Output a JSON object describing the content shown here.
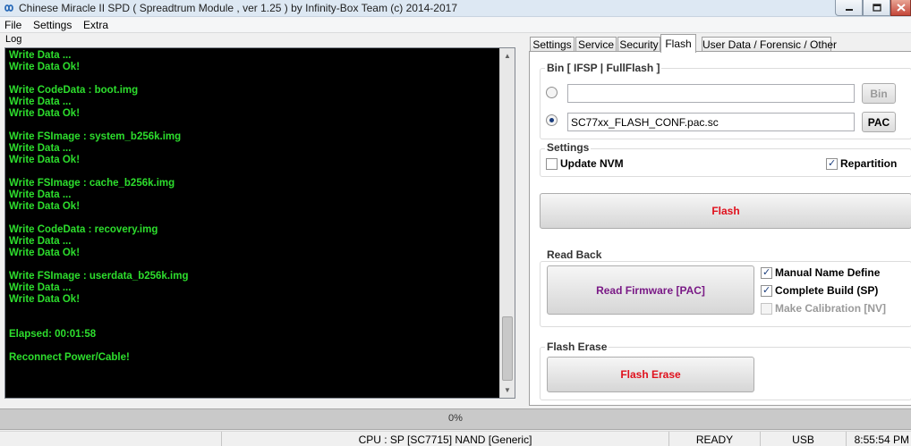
{
  "window": {
    "title": "Chinese Miracle II SPD ( Spreadtrum Module , ver 1.25 ) by Infinity-Box Team (c) 2014-2017"
  },
  "menu": [
    "File",
    "Settings",
    "Extra"
  ],
  "log": {
    "label": "Log",
    "lines": [
      "Write Data ...",
      "Write Data Ok!",
      "",
      "Write CodeData : boot.img",
      "Write Data ...",
      "Write Data Ok!",
      "",
      "Write FSImage : system_b256k.img",
      "Write Data ...",
      "Write Data Ok!",
      "",
      "Write FSImage : cache_b256k.img",
      "Write Data ...",
      "Write Data Ok!",
      "",
      "Write CodeData : recovery.img",
      "Write Data ...",
      "Write Data Ok!",
      "",
      "Write FSImage : userdata_b256k.img",
      "Write Data ...",
      "Write Data Ok!",
      "",
      "",
      "Elapsed: 00:01:58",
      "",
      "Reconnect Power/Cable!"
    ],
    "text_color": "#2dde2d"
  },
  "tabs": [
    "Settings",
    "Service",
    "Security",
    "Flash",
    "User Data / Forensic / Other"
  ],
  "active_tab": "Flash",
  "flash": {
    "bin_group_title": "Bin  [ IFSP | FullFlash ]",
    "bin_path": "",
    "bin_button": "Bin",
    "pac_path": "SC77xx_FLASH_CONF.pac.sc",
    "pac_button": "PAC",
    "settings_title": "Settings",
    "update_nvm": {
      "label": "Update NVM",
      "checked": false
    },
    "repartition": {
      "label": "Repartition",
      "checked": true
    },
    "flash_button": "Flash",
    "flash_button_color": "#e0101c",
    "readback_title": "Read Back",
    "read_firmware_button": "Read Firmware [PAC]",
    "read_firmware_color": "#7a1a86",
    "manual_name": {
      "label": "Manual Name Define",
      "checked": true
    },
    "complete_build": {
      "label": "Complete Build (SP)",
      "checked": true
    },
    "make_calibration": {
      "label": "Make Calibration [NV]",
      "checked": false,
      "disabled": true
    },
    "erase_title": "Flash Erase",
    "flash_erase_button": "Flash Erase",
    "flash_erase_color": "#e0101c"
  },
  "progress": {
    "value": 0,
    "text": "0%"
  },
  "status": {
    "cpu": "CPU : SP [SC7715] NAND [Generic]",
    "state": "READY",
    "port": "USB",
    "time": "8:55:54 PM"
  }
}
